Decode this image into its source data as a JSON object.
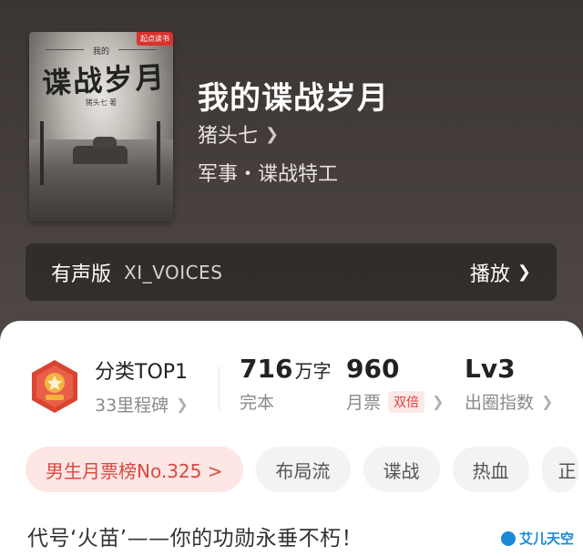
{
  "book": {
    "title": "我的谍战岁月",
    "author": "猪头七",
    "genre": "军事・谍战特工",
    "cover": {
      "small_title": "我的",
      "big_title": "谍战岁月",
      "author_mini": "猪头七 著",
      "badge": "起点读书"
    }
  },
  "audio": {
    "label": "有声版",
    "narrator": "XI_VOICES",
    "play_label": "播放"
  },
  "stats": {
    "category": {
      "main": "分类TOP1",
      "sub": "33里程碑"
    },
    "words": {
      "value": "716",
      "unit": "万字",
      "sub": "完本"
    },
    "tickets": {
      "value": "960",
      "sub": "月票",
      "badge": "双倍"
    },
    "level": {
      "value": "Lv3",
      "sub": "出圈指数"
    }
  },
  "tags": [
    "男生月票榜No.325 >",
    "布局流",
    "谍战",
    "热血",
    "正"
  ],
  "slogan": "代号‘火苗’——你的功勋永垂不朽！",
  "watermark": "艾儿天空",
  "colors": {
    "accent_red": "#e0423a",
    "rank_tag_bg": "#fde6e4",
    "medal_red": "#d9452f",
    "medal_gold": "#f3b33d"
  },
  "icons": {
    "author_chevron": "chevron-right-icon",
    "play_chevron": "chevron-right-icon",
    "medal": "medal-icon"
  }
}
